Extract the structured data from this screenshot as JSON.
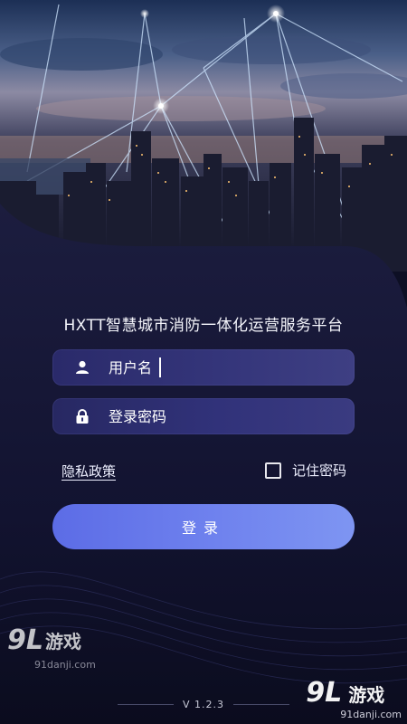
{
  "app": {
    "title": "HXTT智慧城市消防一体化运营服务平台",
    "version": "V 1.2.3"
  },
  "login_form": {
    "username_placeholder": "用户名",
    "password_placeholder": "登录密码",
    "privacy_link": "隐私政策",
    "remember_label": "记住密码",
    "remember_checked": false,
    "submit_label": "登录"
  },
  "watermarks": {
    "left_logo": "9L",
    "left_text": "游戏",
    "left_url": "91danji.com",
    "right_logo": "9L",
    "right_text": "游戏",
    "right_url": "91danji.com"
  },
  "colors": {
    "background": "#0d0f24",
    "field": "#2f3074",
    "button": "#6a7cec"
  },
  "icons": [
    "user-icon",
    "lock-icon"
  ]
}
